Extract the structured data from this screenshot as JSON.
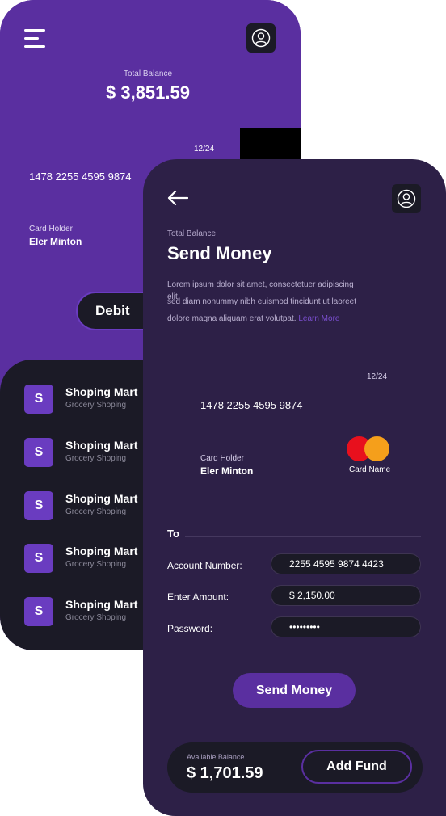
{
  "back_screen": {
    "total_balance_label": "Total Balance",
    "total_balance": "$ 3,851.59",
    "card": {
      "expiry": "12/24",
      "number": "1478 2255 4595 9874",
      "holder_label": "Card Holder",
      "holder_name": "Eler Minton"
    },
    "debit_label": "Debit",
    "transactions": [
      {
        "badge": "S",
        "title": "Shoping Mart",
        "subtitle": "Grocery Shoping"
      },
      {
        "badge": "S",
        "title": "Shoping Mart",
        "subtitle": "Grocery Shoping"
      },
      {
        "badge": "S",
        "title": "Shoping Mart",
        "subtitle": "Grocery Shoping"
      },
      {
        "badge": "S",
        "title": "Shoping Mart",
        "subtitle": "Grocery Shoping"
      },
      {
        "badge": "S",
        "title": "Shoping Mart",
        "subtitle": "Grocery Shoping"
      }
    ]
  },
  "front_screen": {
    "total_balance_label": "Total Balance",
    "title": "Send Money",
    "description": {
      "line1": "Lorem ipsum dolor sit amet, consectetuer adipiscing",
      "line1b": "elit,",
      "line2": "sed diam nonummy nibh euismod tincidunt ut laoreet",
      "line3": "dolore magna aliquam erat volutpat.",
      "learn_more": "Learn More"
    },
    "card": {
      "expiry": "12/24",
      "number": "1478 2255 4595 9874",
      "holder_label": "Card Holder",
      "holder_name": "Eler Minton",
      "card_name": "Card Name"
    },
    "form": {
      "to_label": "To",
      "account_label": "Account Number:",
      "account_value": "2255 4595 9874 4423",
      "amount_label": "Enter Amount:",
      "amount_value": "$ 2,150.00",
      "password_label": "Password:",
      "password_value": "•••••••••"
    },
    "send_button": "Send Money",
    "available_label": "Available Balance",
    "available_balance": "$ 1,701.59",
    "add_fund_button": "Add  Fund"
  },
  "colors": {
    "primary_purple": "#5a2fa0",
    "dark_panel": "#1b1a26",
    "front_bg": "#2d2047",
    "mastercard_red": "#e8101d",
    "mastercard_orange": "#f59f1b"
  }
}
